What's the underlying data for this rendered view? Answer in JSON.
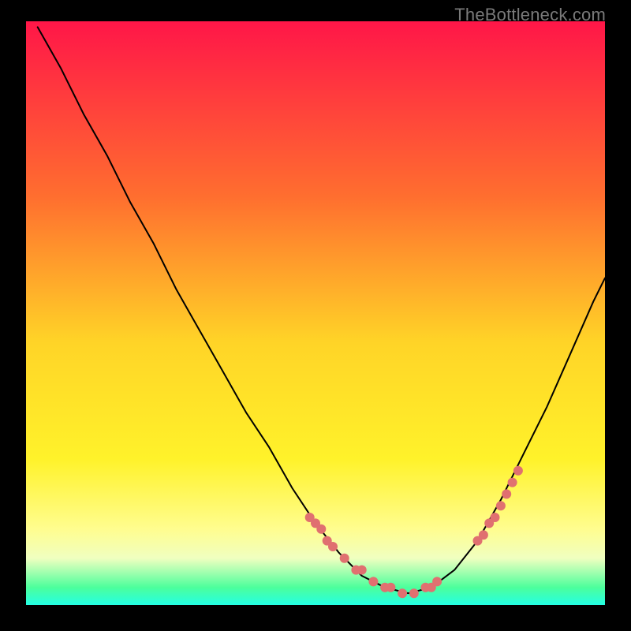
{
  "watermark": "TheBottleneck.com",
  "gradient_stops": [
    {
      "pct": 0,
      "color": "#ff1648"
    },
    {
      "pct": 30,
      "color": "#ff6e2f"
    },
    {
      "pct": 55,
      "color": "#ffd427"
    },
    {
      "pct": 75,
      "color": "#fff22a"
    },
    {
      "pct": 87,
      "color": "#fffd8f"
    },
    {
      "pct": 92,
      "color": "#f0ffc0"
    },
    {
      "pct": 97,
      "color": "#4cff9c"
    },
    {
      "pct": 100,
      "color": "#24ffe4"
    }
  ],
  "chart_data": {
    "type": "line",
    "title": "",
    "xlabel": "",
    "ylabel": "",
    "xlim": [
      0,
      100
    ],
    "ylim": [
      0,
      100
    ],
    "grid": false,
    "legend": false,
    "series": [
      {
        "name": "bottleneck-curve",
        "x": [
          2,
          6,
          10,
          14,
          18,
          22,
          26,
          30,
          34,
          38,
          42,
          46,
          50,
          54,
          58,
          62,
          66,
          70,
          74,
          78,
          82,
          86,
          90,
          94,
          98,
          100
        ],
        "y": [
          99,
          92,
          84,
          77,
          69,
          62,
          54,
          47,
          40,
          33,
          27,
          20,
          14,
          9,
          5,
          3,
          2,
          3,
          6,
          11,
          18,
          26,
          34,
          43,
          52,
          56
        ]
      }
    ],
    "markers": {
      "name": "bottleneck-dots",
      "x": [
        49,
        50,
        51,
        52,
        53,
        55,
        57,
        58,
        60,
        62,
        63,
        65,
        67,
        69,
        70,
        71,
        78,
        79,
        80,
        81,
        82,
        83,
        84,
        85
      ],
      "y": [
        15,
        14,
        13,
        11,
        10,
        8,
        6,
        6,
        4,
        3,
        3,
        2,
        2,
        3,
        3,
        4,
        11,
        12,
        14,
        15,
        17,
        19,
        21,
        23
      ]
    }
  }
}
